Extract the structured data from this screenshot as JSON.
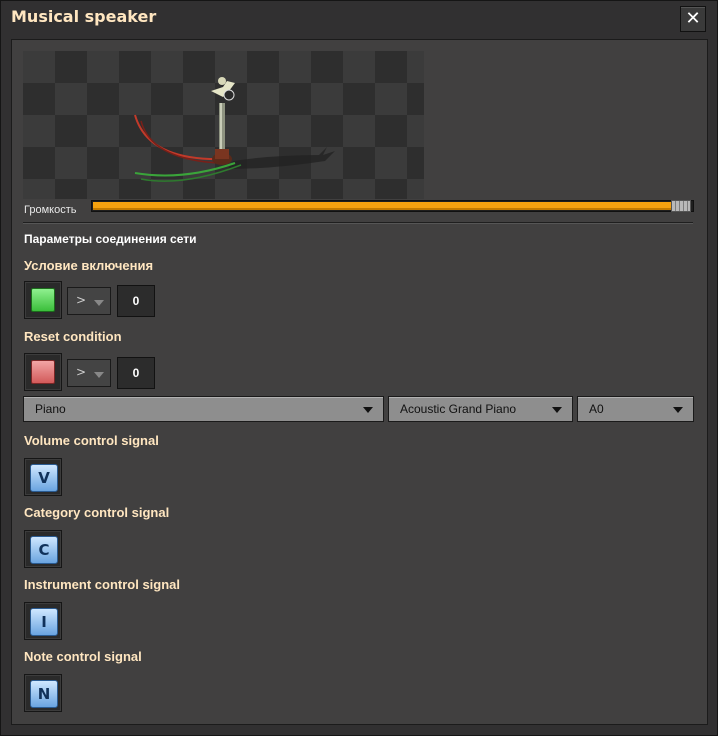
{
  "window": {
    "title": "Musical speaker",
    "close_icon": "close-icon"
  },
  "volume": {
    "label": "Громкость",
    "level_percent": 97,
    "accent_color": "#f6a20f"
  },
  "network": {
    "heading": "Параметры соединения сети"
  },
  "enable_condition": {
    "label": "Условие включения",
    "signal_color": "#5fd65f",
    "comparator": ">",
    "value": "0"
  },
  "reset_condition": {
    "label": "Reset condition",
    "signal_color": "#e07a7a",
    "comparator": ">",
    "value": "0"
  },
  "selectors": {
    "category": "Piano",
    "instrument": "Acoustic Grand Piano",
    "note": "A0"
  },
  "signals": [
    {
      "label": "Volume control signal",
      "letter": "V"
    },
    {
      "label": "Category control signal",
      "letter": "C"
    },
    {
      "label": "Instrument control signal",
      "letter": "I"
    },
    {
      "label": "Note control signal",
      "letter": "N"
    }
  ]
}
